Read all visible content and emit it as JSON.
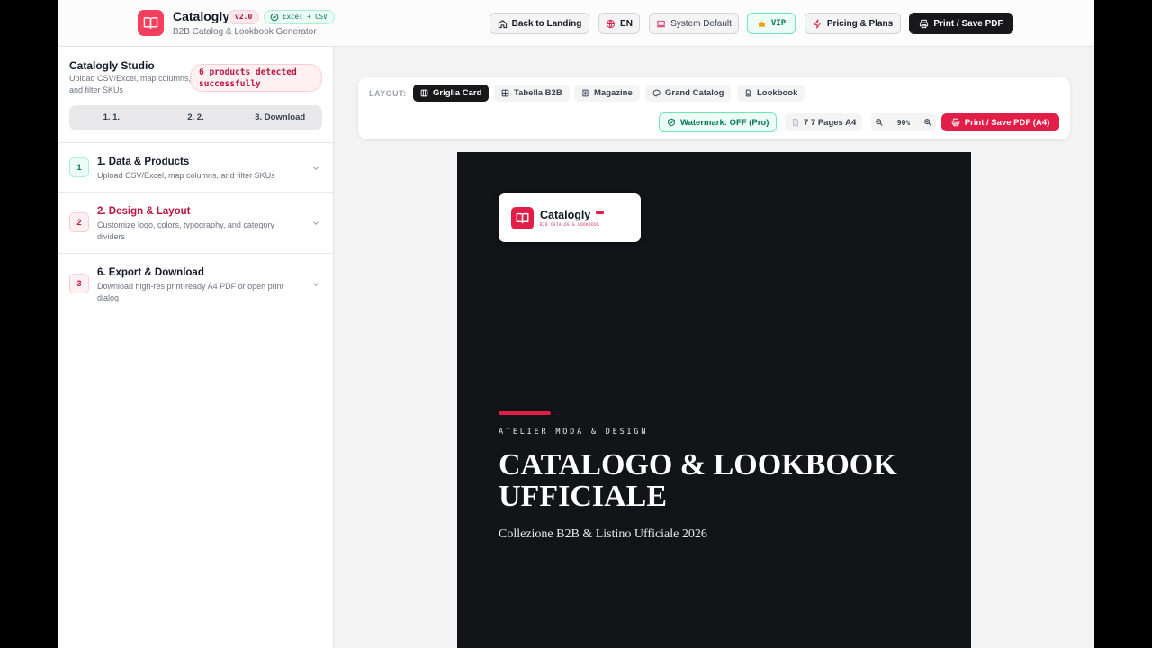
{
  "header": {
    "app_name": "Catalogly",
    "tagline": "B2B Catalog & Lookbook Generator",
    "version": "v2.0",
    "format_badge": "Excel + CSV",
    "back_label": "Back to Landing",
    "lang_label": "EN",
    "theme_label": "System Default",
    "vip_label": "VIP",
    "pricing_label": "Pricing & Plans",
    "print_label": "Print / Save PDF"
  },
  "sidebar": {
    "title": "Catalogly Studio",
    "subtitle": "Upload CSV/Excel, map columns, and filter SKUs",
    "detect_badge": "6 products detected successfully",
    "steps": [
      "1. 1.",
      "2. 2.",
      "3. Download"
    ],
    "sections": [
      {
        "num": "1",
        "title": "1. Data & Products",
        "desc": "Upload CSV/Excel, map columns, and filter SKUs"
      },
      {
        "num": "2",
        "title": "2. Design & Layout",
        "desc": "Customize logo, colors, typography, and category dividers"
      },
      {
        "num": "3",
        "title": "6. Export & Download",
        "desc": "Download high-res print-ready A4 PDF or open print dialog"
      }
    ]
  },
  "toolbar": {
    "layout_label": "LAYOUT:",
    "layouts": [
      "Griglia Card",
      "Tabella B2B",
      "Magazine",
      "Grand Catalog",
      "Lookbook"
    ],
    "active_layout": "Griglia Card",
    "watermark_label": "Watermark: OFF (Pro)",
    "pages_label": "7 7 Pages A4",
    "zoom_value": "90%",
    "print_a4_label": "Print / Save PDF (A4)"
  },
  "preview": {
    "logo_name": "Catalogly",
    "logo_sub": "B2B CATALOG & LOOKBOOK",
    "kicker": "ATELIER MODA & DESIGN",
    "title": "CATALOGO & LOOKBOOK UFFICIALE",
    "subtitle": "Collezione B2B & Listino Ufficiale 2026"
  },
  "colors": {
    "accent": "#e11d48",
    "dark": "#18181b",
    "success": "#047857",
    "page_bg": "#131418"
  }
}
